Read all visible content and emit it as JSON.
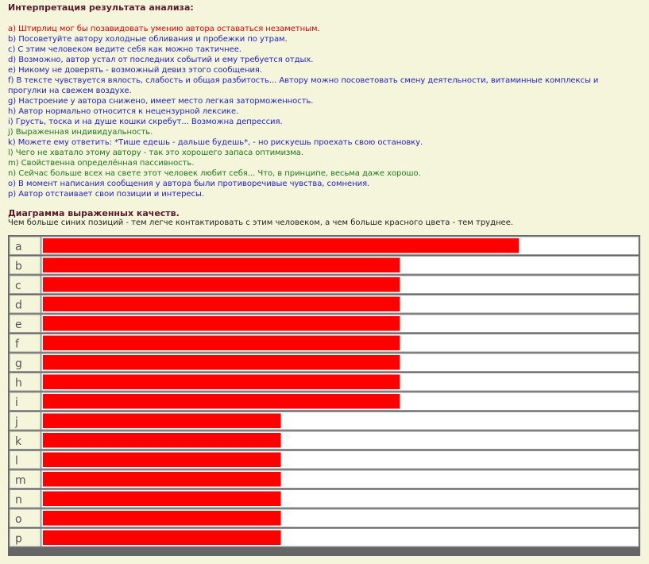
{
  "interpretation": {
    "title": "Интерпретация результата анализа:",
    "lines": [
      {
        "text": "a) Штирлиц мог бы позавидовать умению автора оставаться незаметным.",
        "color": "red"
      },
      {
        "text": "b) Посоветуйте автору холодные обливания и пробежки по утрам.",
        "color": "blue"
      },
      {
        "text": "c) С этим человеком ведите себя как можно тактичнее.",
        "color": "blue"
      },
      {
        "text": "d) Возможно, автор устал от последних событий и ему требуется отдых.",
        "color": "blue"
      },
      {
        "text": "e) Никому не доверять - возможный девиз этого сообщения.",
        "color": "blue"
      },
      {
        "text": "f) В тексте чувствуется вялость, слабость и общая разбитость... Автору можно посоветовать смену деятельности, витаминные комплексы и прогулки на свежем воздухе.",
        "color": "blue"
      },
      {
        "text": "g) Настроение у автора снижено, имеет место легкая заторможенность.",
        "color": "blue"
      },
      {
        "text": "h) Автор нормально относится к нецензурной лексике.",
        "color": "blue"
      },
      {
        "text": "i) Грусть, тоска и на душе кошки скребут... Возможна депрессия.",
        "color": "blue"
      },
      {
        "text": "j) Выраженная индивидуальность.",
        "color": "green"
      },
      {
        "text": "k) Можете ему ответить: *Тише едешь - дальше будешь*, - но рискуешь проехать свою остановку.",
        "color": "blue"
      },
      {
        "text": "l) Чего не хватало этому автору - так это хорошего запаса оптимизма.",
        "color": "green"
      },
      {
        "text": "m) Свойственна определённая пассивность.",
        "color": "green"
      },
      {
        "text": "n) Сейчас больше всех на свете этот человек любит себя... Что, в принципе, весьма даже хорошо.",
        "color": "green"
      },
      {
        "text": "o) В момент написания сообщения у автора были противоречивые чувства, сомнения.",
        "color": "blue"
      },
      {
        "text": "p) Автор отстаивает свои позиции и интересы.",
        "color": "blue"
      }
    ]
  },
  "colors": {
    "red": "#e60000",
    "blue": "#1f1fcc",
    "green": "#1a7a1a",
    "heading": "#5a1a2c",
    "background": "#f5f5dc",
    "bar": "#ff0000",
    "track": "#ffffff",
    "border": "#555555"
  },
  "chart_data": {
    "type": "bar",
    "orientation": "horizontal",
    "title": "Диаграмма выраженных качеств.",
    "subtitle": "Чем больше синих позиций - тем легче контактировать с этим человеком, а чем больше красного цвета - тем труднее.",
    "categories": [
      "a",
      "b",
      "c",
      "d",
      "e",
      "f",
      "g",
      "h",
      "i",
      "j",
      "k",
      "l",
      "m",
      "n",
      "o",
      "p"
    ],
    "values": [
      80,
      60,
      60,
      60,
      60,
      60,
      60,
      60,
      60,
      40,
      40,
      40,
      40,
      40,
      40,
      40
    ],
    "xlim": [
      0,
      100
    ],
    "grid": false,
    "legend": "none"
  }
}
